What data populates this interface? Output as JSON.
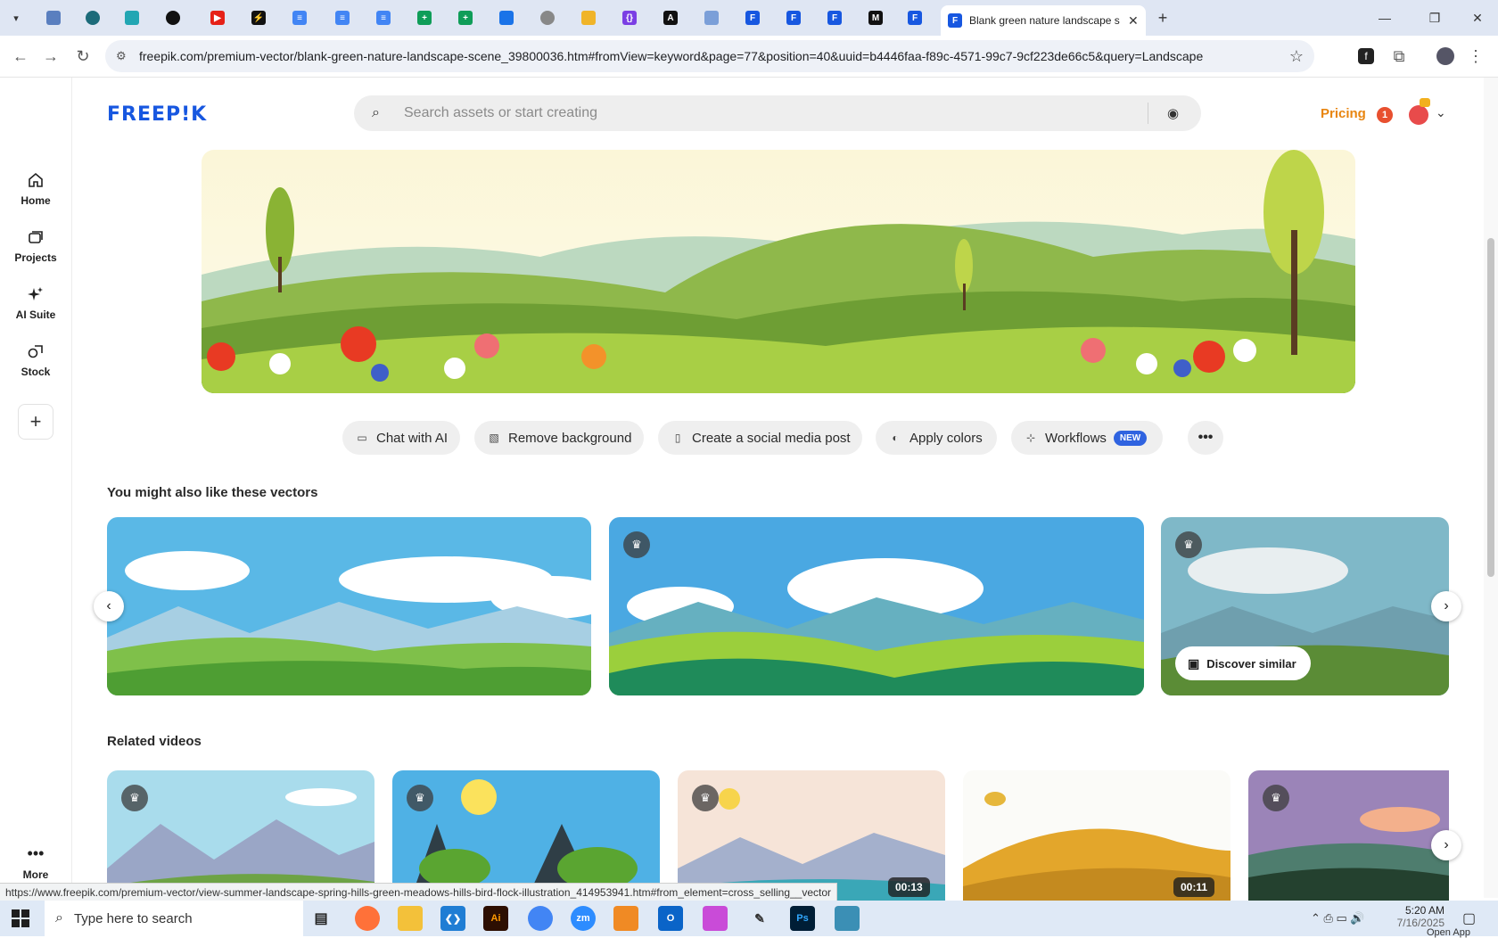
{
  "browser": {
    "active_tab_title": "Blank green nature landscape s",
    "url": "freepik.com/premium-vector/blank-green-nature-landscape-scene_39800036.htm#fromView=keyword&page=77&position=40&uuid=b4446faa-f89c-4571-99c7-9cf223de66c5&query=Landscape",
    "status_url": "https://www.freepik.com/premium-vector/view-summer-landscape-spring-hills-green-meadows-hills-bird-flock-illustration_414953941.htm#from_element=cross_selling__vector"
  },
  "header": {
    "logo": "FREEP!K",
    "search_placeholder": "Search assets or start creating",
    "pricing": "Pricing",
    "notification_count": "1"
  },
  "sidebar": {
    "items": [
      {
        "label": "Home",
        "icon": "home-icon"
      },
      {
        "label": "Projects",
        "icon": "projects-icon"
      },
      {
        "label": "AI Suite",
        "icon": "sparkle-icon"
      },
      {
        "label": "Stock",
        "icon": "stock-icon"
      }
    ],
    "more_label": "More"
  },
  "actions": [
    {
      "label": "Chat with AI",
      "icon": "chat-ai-icon"
    },
    {
      "label": "Remove background",
      "icon": "remove-bg-icon"
    },
    {
      "label": "Create a social media post",
      "icon": "phone-icon"
    },
    {
      "label": "Apply colors",
      "icon": "palette-icon"
    },
    {
      "label": "Workflows",
      "icon": "workflow-icon",
      "badge": "NEW"
    }
  ],
  "vectors_section": {
    "title": "You might also like these vectors",
    "discover_label": "Discover similar"
  },
  "videos_section": {
    "title": "Related videos",
    "durations": [
      "00:13",
      "00:11"
    ]
  },
  "taskbar": {
    "search_placeholder": "Type here to search",
    "time": "5:20 AM",
    "date": "7/16/2025",
    "open_app": "Open App"
  },
  "colors": {
    "brand_blue": "#1757e0",
    "pricing_orange": "#e8850f",
    "new_badge": "#2f63e0"
  }
}
